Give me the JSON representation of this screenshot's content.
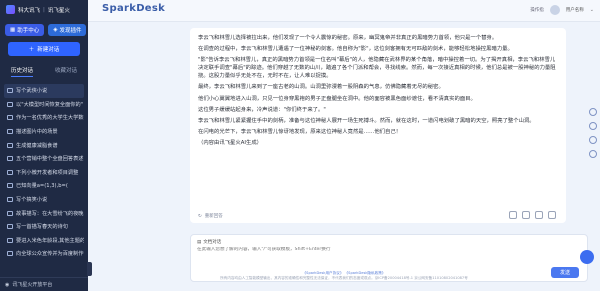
{
  "sidebar": {
    "brand_left": "科大讯飞",
    "brand_right": "讯飞星火",
    "assistant_btn": "助手中心",
    "discover_btn": "发现插件",
    "new_chat": "新建对话",
    "tab_history": "历史对话",
    "tab_favorites": "收藏对话",
    "history": [
      "写个武侠小说",
      "以\"大模型时间恢复全面你的\"",
      "作为一名优秀的大学生大学数学讲授",
      "描述图片中的场景",
      "生成健康减脂食谱",
      "五个营销中整个全盘回答表述",
      "下列小微开发者和项目调整",
      "已知向量a=(1,3),b=(",
      "写个搞笑小说",
      "故事描写：在大雪纷飞的夜晚...",
      "写一首描写春天的诗句",
      "要进入米色年龄段,其他主题的",
      "向全球公众宣传并为百度制作一个"
    ],
    "footer": "讯飞星火开放平台"
  },
  "header": {
    "title": "SparkDesk",
    "right_link": "操作指",
    "user": "用户名称"
  },
  "answer": {
    "paragraphs": [
      "李云飞和林雪儿选择被拉出来，他们发现了一个令人震惊的秘密。原来，幽冥鬼帝并非真正的黑暗势力首领，他只是一个替身。",
      "在调查的过程中，李云飞和林雪儿遭遇了一位神秘的剑客。他自称为\"影\"，这位剑客拥有无可匹敌的剑术，能够轻松地操控黑暗力量。",
      "\"影\"告诉李云飞和林雪儿，真正的黑暗势力首领是一位名叫\"幕后\"的人，他隐藏在武林界的某个角落，暗中操控着一切。为了揭开真相，李云飞和林雪儿决定联手调查\"幕后\"的踪迹。他们穿越了无数的山川，踏遍了各个门派和帮会，寻找线索。然而，每一次接近真相的时候，他们总是被一股神秘的力量阻挠。这股力量似乎无处不在，无时不在，让人难以捉摸。",
      "最终，李云飞和林雪儿来到了一座古老的山洞。山洞里弥漫着一股阴森的气息，仿佛隐藏着无尽的秘密。",
      "他们小心翼翼地进入山洞，只见一位身穿黑袍的男子正盘腿坐在洞中。他的面容被黑色面纱遮住，看不清真实的面目。",
      "这位男子缓缓站起身来，冷声说道：\"你们终于来了。\"",
      "李云飞和林雪儿紧紧握住手中的剑柄，准备与这位神秘人展开一场生死搏斗。然而，就在这时，一道闪电划破了黑暗的天空，照亮了整个山洞。",
      "在闪电的光芒下，李云飞和林雪儿惊讶地发现，原来这位神秘人竟然是……他们自己！",
      "（内容由讯飞星火AI生成）"
    ],
    "regen": "重新回答"
  },
  "input": {
    "label": "文档对话",
    "placeholder": "在此输入您想了解的内容，输入\"/\"可获取模板，Shift+Enter换行",
    "send": "发送"
  },
  "footer": {
    "line1_a": "《SparkDesk用户协议》",
    "line1_b": "《SparkDesk隐私政策》",
    "line2": "所有内容均由人工智能模型输出，其内容的准确性和完整性无法保证，不代表我们的态度或观点。京ICP备20004418号-1  京公网安备11010802041087号"
  },
  "colors": {
    "sidebar_bg": "#1f2a44",
    "accent": "#2f64ff",
    "page_bg": "#eef3fb"
  }
}
